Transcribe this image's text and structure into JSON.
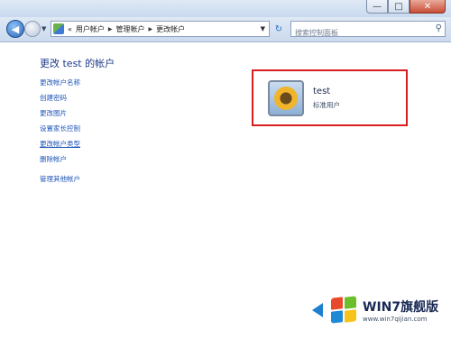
{
  "navbar": {
    "breadcrumbs": [
      "用户帐户",
      "管理帐户",
      "更改帐户"
    ],
    "search_placeholder": "搜索控制面板"
  },
  "main": {
    "heading": "更改 test 的帐户",
    "tasks": [
      {
        "label": "更改帐户名称"
      },
      {
        "label": "创建密码"
      },
      {
        "label": "更改图片"
      },
      {
        "label": "设置家长控制"
      },
      {
        "label": "更改帐户类型"
      },
      {
        "label": "删除帐户"
      },
      {
        "label": "管理其他帐户"
      }
    ]
  },
  "account": {
    "name": "test",
    "type": "标准用户",
    "highlight_color": "#d81e1e"
  },
  "watermark": {
    "title": "WIN7旗舰版",
    "url": "www.win7qijian.com"
  },
  "icons": [
    "back-icon",
    "forward-icon",
    "control-panel-icon",
    "refresh-icon",
    "search-icon",
    "user-picture-icon",
    "windows-logo-icon"
  ]
}
